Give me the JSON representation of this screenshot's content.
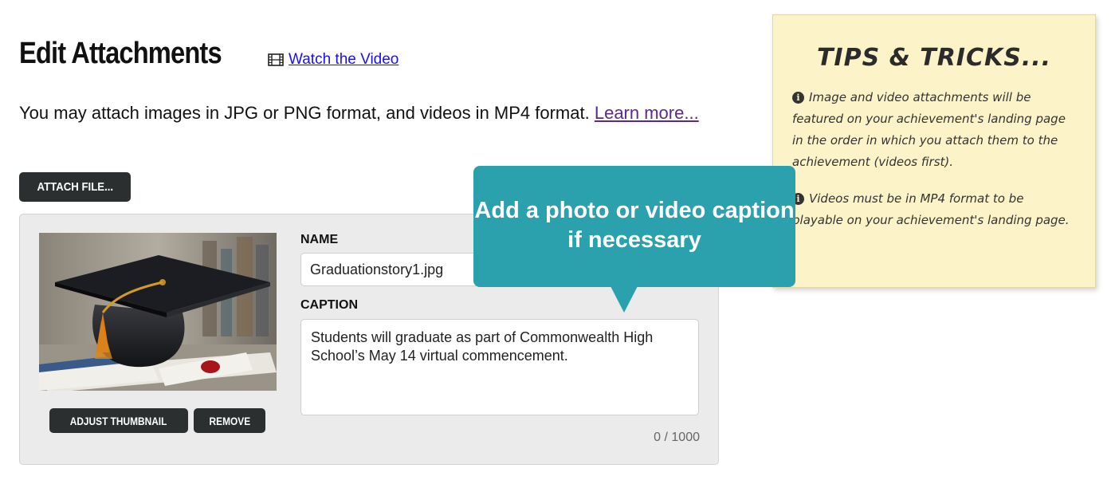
{
  "header": {
    "title": "Edit Attachments",
    "video_link": "Watch the Video",
    "video_icon": "film-icon"
  },
  "intro": {
    "text": "You may attach images in JPG or PNG format, and videos in MP4 format. ",
    "learn_more": "Learn more..."
  },
  "toolbar": {
    "attach_label": "ATTACH FILE..."
  },
  "attachment": {
    "thumbnail_icon": "graduation-cap-image",
    "adjust_label": "ADJUST THUMBNAIL",
    "remove_label": "REMOVE",
    "name_label": "NAME",
    "name_value": "Graduationstory1.jpg",
    "caption_label": "CAPTION",
    "caption_value": "Students will graduate as part of Commonwealth High School’s May 14 virtual commencement.",
    "char_count": "0 / 1000"
  },
  "tips": {
    "title": "TIPS & TRICKS...",
    "items": [
      "Image and video attachments will be featured on your achievement's landing page in the order in which you attach them to the achievement (videos first).",
      "Videos must be in MP4 format to be playable on your achievement's landing page."
    ],
    "info_icon": "i"
  },
  "callout": {
    "text": "Add a photo or video caption if necessary"
  },
  "colors": {
    "dark_button": "#2b2f2f",
    "callout": "#2aa1ad",
    "tips_background": "#fcf3c8",
    "link": "#1a0dff",
    "visited_link": "#5b2a8f"
  }
}
